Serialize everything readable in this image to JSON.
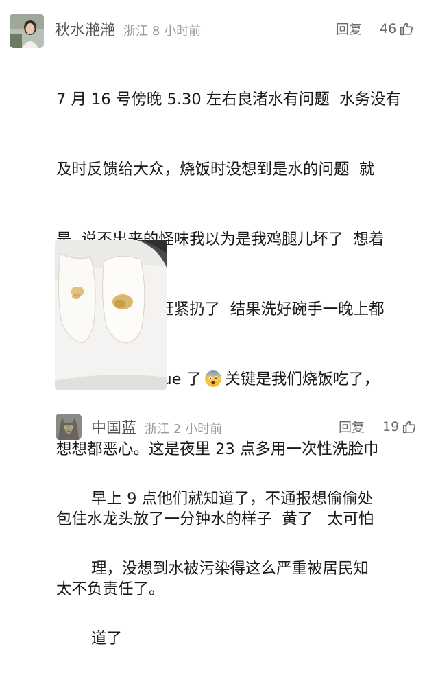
{
  "comments": [
    {
      "username": "秋水滟滟",
      "region": "浙江",
      "time": "8 小时前",
      "reply_label": "回复",
      "likes": "46",
      "lines_before_emoji": [
        "7 月 16 号傍晚 5.30 左右良渚水有问题  水务没有",
        "及时反馈给大众，烧饭时没想到是水的问题  就",
        "是  说不出来的怪味我以为是我鸡腿儿坏了  想着",
        "怎么越洗越臭  赶紧扔了  结果洗好碗手一晚上都"
      ],
      "emoji_line_before": "是怪味   瞬间 yue 了",
      "emoji_name": "anxious-face-with-sweat-icon",
      "emoji_line_after": "关键是我们烧饭吃了，",
      "lines_after_emoji": [
        "想想都恶心。这是夜里 23 点多用一次性洗脸巾",
        "包住水龙头放了一分钟水的样子  黄了   太可怕",
        "太不负责任了。"
      ]
    },
    {
      "username": "中国蓝",
      "region": "浙江",
      "time": "2 小时前",
      "reply_label": "回复",
      "likes": "19",
      "lines": [
        "早上 9 点他们就知道了，不通报想偷偷处",
        "理，没想到水被污染得这么严重被居民知",
        "道了"
      ]
    }
  ],
  "colors": {
    "username": "#555555",
    "meta": "#9a9a9a",
    "text": "#1a1a1a",
    "stain": "#c9a043"
  }
}
